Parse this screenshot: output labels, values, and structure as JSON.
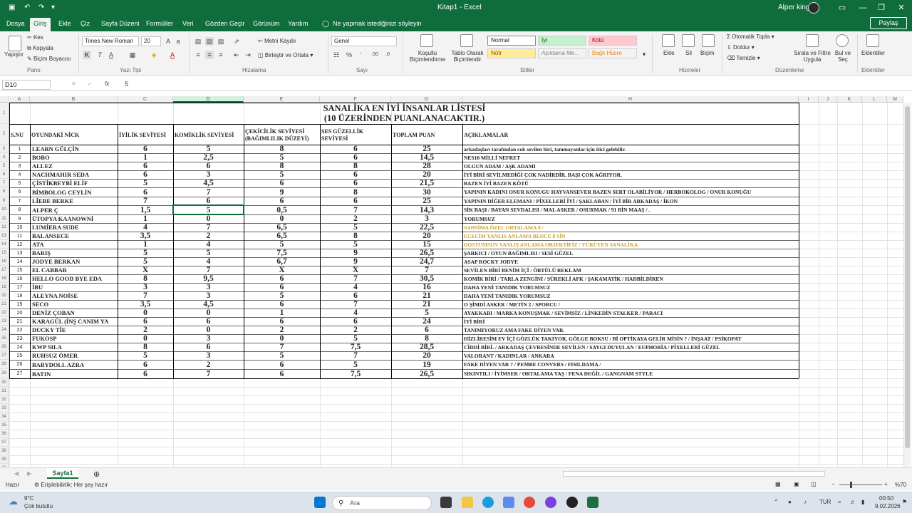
{
  "window": {
    "title": "Kitap1  -  Excel",
    "user": "Alper king"
  },
  "qat": {
    "save": "💾",
    "undo": "↶",
    "redo": "↷",
    "more": "≡"
  },
  "ribbon_tabs": [
    "Dosya",
    "Giriş",
    "Ekle",
    "Çiz",
    "Sayfa Düzeni",
    "Formüller",
    "Veri",
    "Gözden Geçir",
    "Görünüm",
    "Yardım"
  ],
  "tell_me": "Ne yapmak istediğinizi söyleyin",
  "share": "Paylaş",
  "ribbon": {
    "paste": "Yapıştır",
    "cut": "Kes",
    "copy": "Kopyala",
    "format_painter": "Biçim Boyacısı",
    "clipboard": "Pano",
    "font_name": "Times New Roman",
    "font_size": "20",
    "font_group": "Yazı Tipi",
    "wrap": "Metni Kaydır",
    "merge": "Birleştir ve Ortala",
    "alignment": "Hizalama",
    "number_format": "Genel",
    "number": "Sayı",
    "cond_format": "Koşullu Biçimlendirme",
    "format_table": "Tablo Olarak Biçimlendir",
    "style_normal": "Normal",
    "style_good": "İyi",
    "style_bad": "Kötü",
    "style_neutral": "Nötr",
    "style_explain": "Açıklama Me...",
    "style_linked": "Bağlı Hücre",
    "styles": "Stiller",
    "insert": "Ekle",
    "delete": "Sil",
    "format": "Biçim",
    "cells": "Hücreler",
    "autosum": "Otomatik Topla",
    "fill": "Doldur",
    "clear": "Temizle",
    "sort": "Sırala ve Filtre Uygula",
    "find": "Bul ve Seç",
    "editing": "Düzenleme",
    "addins": "Eklentiler",
    "addins_grp": "Eklentiler"
  },
  "formula_bar": {
    "name_box": "D10",
    "fx": "fx",
    "value": "5"
  },
  "sheet": {
    "title1": "SANALİKA EN İYİ İNSANLAR LİSTESİ",
    "title2": "(10 ÜZERİNDEN PUANLANACAKTIR.)",
    "headers": [
      "S.NU",
      "OYUNDAKİ NİCK",
      "İYİLİK SEVİYESİ",
      "KOMİKLİK SEVİYESİ",
      "ÇEKİCİLİK SEVİYESİ (BAĞIMLILIK DÜZEYİ)",
      "SES GÜZELLİK SEVİYESİ",
      "TOPLAM PUAN",
      "AÇIKLAMALAR"
    ],
    "rows": [
      [
        "1",
        "LEARN GÜLÇİN",
        "6",
        "5",
        "8",
        "6",
        "25",
        "arkadaşları tarafından cok sevilen biri, tanımayanlar için itici gelebilir."
      ],
      [
        "2",
        "BOBO",
        "1",
        "2,5",
        "5",
        "6",
        "14,5",
        "NES10 MİLLİ NEFRET"
      ],
      [
        "3",
        "ALLEZ",
        "6",
        "6",
        "8",
        "8",
        "28",
        "OLGUN ADAM / AŞK ADAMI"
      ],
      [
        "4",
        "NACHMAHIR SEDA",
        "6",
        "3",
        "5",
        "6",
        "20",
        "İYİ BİRİ SEVİLMEDİĞİ ÇOK NADİRDİR. BAŞI ÇOK AĞRIYOR."
      ],
      [
        "5",
        "ÇİSTİKBEYBİ ELİF",
        "5",
        "4,5",
        "6",
        "6",
        "21,5",
        "BAZEN İYİ BAZEN KÖTÜ"
      ],
      [
        "6",
        "BİMBOLOG CEYLİN",
        "6",
        "7",
        "9",
        "8",
        "30",
        "YAPININ KADINI ONUR KONUGU HAYVANSEVER BAZEN SERT OLABİLİYOR / HERBOKOLOG / ONUR KONUĞU"
      ],
      [
        "7",
        "LİEBE BERKE",
        "7",
        "6",
        "6",
        "6",
        "25",
        "YAPININ DİĞER ELEMANI / PİXELLERİ İYİ / ŞAKLABAN / İYİ BİR ARKADAŞ / İKON"
      ],
      [
        "8",
        "ALPER Ç",
        "1,5",
        "5",
        "0,5",
        "7",
        "14,3",
        "SİK BAŞI / BAYAN SEVDALISI / MAL ASKER / OSURMAK / 91 BİN MAAŞ / ."
      ],
      [
        "9",
        "ÜTOPYA KAANOWNİ",
        "1",
        "0",
        "0",
        "2",
        "3",
        "YORUMSUZ"
      ],
      [
        "10",
        "LUMİERA SUDE",
        "4",
        "7",
        "6,5",
        "5",
        "22,5",
        "SAHSİMA ÖZEL ORTALAMA 8 /"
      ],
      [
        "11",
        "BALANSECE",
        "3,5",
        "2",
        "6,5",
        "8",
        "20",
        "ECECİM YANLIS ANLAMA BENCE 8 SİN"
      ],
      [
        "12",
        "ATA",
        "1",
        "4",
        "5",
        "5",
        "15",
        "DOSTUMSUN YANLIŞ ANLAMA OBJEKTİFİZ / YÜRÜYEN SANALİKA"
      ],
      [
        "13",
        "BARIŞ",
        "5",
        "5",
        "7,5",
        "9",
        "26,5",
        "ŞARKICI / OYUN BAĞIMLISI / SESİ GÜZEL"
      ],
      [
        "14",
        "JODYE BERKAN",
        "5",
        "4",
        "6,7",
        "9",
        "24,7",
        "ASAP ROCKY JODYE"
      ],
      [
        "15",
        "EL CABBAR",
        "X",
        "7",
        "X",
        "X",
        "7",
        "SEVİLEN BİRİ BENİM İÇİ / ÖRTÜLÜ REKLAM"
      ],
      [
        "16",
        "HELLO GOOD BYE EDA",
        "8",
        "9,5",
        "6",
        "7",
        "30,5",
        "KOMİK BİRİ / TARLA ZENGİNİ / SÜREKLİ AFK / ŞAKAMATİK / HADBİLDİREN"
      ],
      [
        "17",
        "İBU",
        "3",
        "3",
        "6",
        "4",
        "16",
        "DAHA YENİ TANIDIK YORUMSUZ"
      ],
      [
        "18",
        "ALEYNA NOİSE",
        "7",
        "3",
        "5",
        "6",
        "21",
        "DAHA YENİ TANIDIK YORUMSUZ"
      ],
      [
        "19",
        "SECO",
        "3,5",
        "4,5",
        "6",
        "7",
        "21",
        "O ŞİMDİ ASKER / METİN 2 / SPORCU /"
      ],
      [
        "20",
        "DENİZ ÇOBAN",
        "0",
        "0",
        "1",
        "4",
        "5",
        "AYAKKABI / MARKA KONUŞMAK / SEVİMSİZ / LİNKEDİN STALKER / PARACI"
      ],
      [
        "21",
        "KARAGÜL (İNŞ CANIM YA",
        "6",
        "6",
        "6",
        "6",
        "24",
        "İYİ BİRİ"
      ],
      [
        "22",
        "DUCKY TİE",
        "2",
        "0",
        "2",
        "2",
        "6",
        "TANIMIYORUZ AMA FAKE DİYEN VAR."
      ],
      [
        "23",
        "FUKOSP",
        "0",
        "3",
        "0",
        "5",
        "8",
        "HİZLİRESİM EV İÇİ GÖZLÜK TAKIYOR. GÖLGE BOKSU / Bİ OPTİKAYA GELİR MİSİN ? / İNŞAAT / PSİKOPAT"
      ],
      [
        "24",
        "KWP SILA",
        "8",
        "6",
        "7",
        "7,5",
        "28,5",
        "CİDDİ BİRİ. / ARKADAŞ ÇEVRESİNDE SEVİLEN / SAYGI DUYULAN / EUPHORİA / PİXELLERİ GÜZEL"
      ],
      [
        "25",
        "RUHSUZ ÖMER",
        "5",
        "3",
        "5",
        "7",
        "20",
        "VALORANT / KADINLAR / ANKARA"
      ],
      [
        "26",
        "BABYDOLL AZRA",
        "6",
        "2",
        "6",
        "5",
        "19",
        "FAKE DİYEN VAR ? / PEMBE CONVERS / FISILDAMA /"
      ],
      [
        "27",
        "BATIN",
        "6",
        "7",
        "6",
        "7,5",
        "26,5",
        "SIKINTILI / İYİMSER / ORTALAMA YAŞ / FENA DEĞİL / GANGNAM STYLE"
      ]
    ],
    "desc_colors": {
      "10": "#c9a227",
      "11": "#c9a227",
      "12": "#c9a227"
    }
  },
  "columns": [
    "A",
    "B",
    "C",
    "D",
    "E",
    "F",
    "G",
    "H",
    "I",
    "J",
    "K",
    "L",
    "M"
  ],
  "row_numbers": [
    "1",
    "2",
    "3",
    "4",
    "5",
    "6",
    "7",
    "8",
    "9",
    "10",
    "11",
    "12",
    "13",
    "14",
    "15",
    "16",
    "17",
    "18",
    "19",
    "20",
    "21",
    "22",
    "23",
    "24",
    "25",
    "26",
    "27",
    "28",
    "29",
    "30",
    "31",
    "32",
    "33",
    "34",
    "35",
    "36",
    "37",
    "38",
    "39",
    "40",
    "41"
  ],
  "sheet_tab": "Sayfa1",
  "status": {
    "ready": "Hazır",
    "accessibility": "Erişilebilirlik: Her şey hazır",
    "zoom": "%70"
  },
  "taskbar": {
    "weather_temp": "9°C",
    "weather_desc": "Çok bulutlu",
    "search": "Ara",
    "lang": "TUR",
    "time": "00:50",
    "date": "9.02.2026"
  }
}
